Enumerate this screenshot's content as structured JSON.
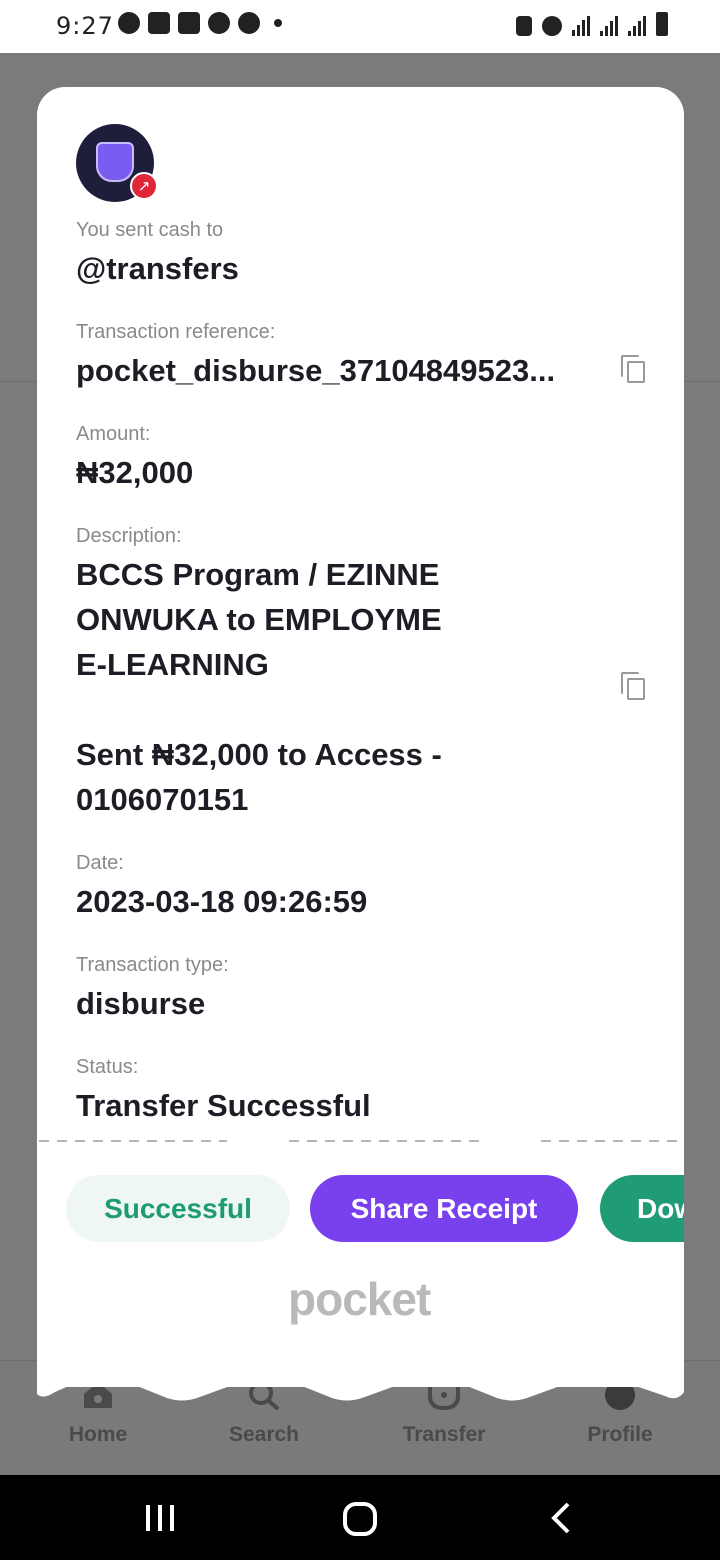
{
  "status_bar": {
    "time": "9:27"
  },
  "bottom_nav": {
    "home": "Home",
    "search": "Search",
    "transfer": "Transfer",
    "profile": "Profile"
  },
  "receipt": {
    "header_label": "You sent cash to",
    "recipient": "@transfers",
    "reference_label": "Transaction reference:",
    "reference_value": "pocket_disburse_37104849523...",
    "amount_label": "Amount:",
    "amount_value": "₦32,000",
    "description_label": "Description:",
    "description_lines": [
      "BCCS Program / EZINNE",
      "ONWUKA to EMPLOYME",
      "E-LEARNING",
      "",
      "Sent ₦32,000 to Access -",
      "0106070151"
    ],
    "date_label": "Date:",
    "date_value": "2023-03-18 09:26:59",
    "type_label": "Transaction type:",
    "type_value": "disburse",
    "status_label": "Status:",
    "status_value": "Transfer Successful"
  },
  "actions": {
    "status_pill": "Successful",
    "share": "Share Receipt",
    "download": "Dow"
  },
  "brand": {
    "logo_text": "pocket"
  },
  "colors": {
    "primary": "#7940ee",
    "success": "#1f9b70",
    "danger": "#e0273a"
  },
  "icons": {
    "copy": "copy-icon",
    "home": "home-icon",
    "search": "search-icon",
    "transfer": "transfer-icon"
  }
}
